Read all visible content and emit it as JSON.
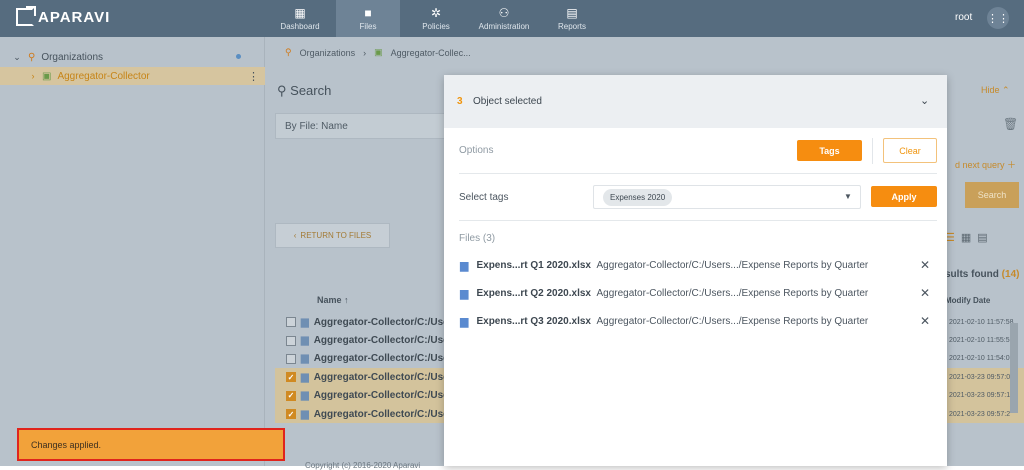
{
  "app": {
    "brand": "APARAVI"
  },
  "nav": [
    {
      "label": "Dashboard",
      "icon": "dashboard-icon"
    },
    {
      "label": "Files",
      "icon": "folder-icon"
    },
    {
      "label": "Policies",
      "icon": "gear-icon"
    },
    {
      "label": "Administration",
      "icon": "people-icon"
    },
    {
      "label": "Reports",
      "icon": "clipboard-icon"
    }
  ],
  "user": {
    "name": "root"
  },
  "sidebar": {
    "root": {
      "label": "Organizations"
    },
    "child": {
      "label": "Aggregator-Collector"
    }
  },
  "breadcrumb": [
    "Organizations",
    "Aggregator-Collec..."
  ],
  "search": {
    "title": "Search",
    "by_file": "By File: Name",
    "hide_label": "Hide",
    "next_query": "d next query",
    "search_button": "Search"
  },
  "results": {
    "return_label": "RETURN TO FILES",
    "found_label": "sults found",
    "count": "(14)",
    "col_name": "Name",
    "col_date": "Modify Date",
    "rows": [
      {
        "path": "Aggregator-Collector/C:/Use",
        "date": "2021-02-10 11:57:58",
        "checked": false
      },
      {
        "path": "Aggregator-Collector/C:/Use",
        "date": "2021-02-10 11:55:59",
        "checked": false
      },
      {
        "path": "Aggregator-Collector/C:/Use",
        "date": "2021-02-10 11:54:01",
        "checked": false
      },
      {
        "path": "Aggregator-Collector/C:/Use",
        "date": "2021-03-23 09:57:0",
        "checked": true
      },
      {
        "path": "Aggregator-Collector/C:/Use",
        "date": "2021-03-23 09:57:1",
        "checked": true
      },
      {
        "path": "Aggregator-Collector/C:/Use",
        "date": "2021-03-23 09:57:2",
        "checked": true
      }
    ]
  },
  "footer": {
    "copyright": "Copyright (c) 2016-2020 Aparavi"
  },
  "modal": {
    "selected_count": "3",
    "selected_text": "Object selected",
    "options_label": "Options",
    "tags_button": "Tags",
    "clear_button": "Clear",
    "select_tags_label": "Select tags",
    "selected_tag": "Expenses 2020",
    "apply_button": "Apply",
    "files_label": "Files (3)",
    "files": [
      {
        "name": "Expens...rt Q1 2020.xlsx",
        "path": "Aggregator-Collector/C:/Users.../Expense Reports by Quarter"
      },
      {
        "name": "Expens...rt Q2 2020.xlsx",
        "path": "Aggregator-Collector/C:/Users.../Expense Reports by Quarter"
      },
      {
        "name": "Expens...rt Q3 2020.xlsx",
        "path": "Aggregator-Collector/C:/Users.../Expense Reports by Quarter"
      }
    ]
  },
  "toast": {
    "message": "Changes applied."
  },
  "colors": {
    "accent": "#f68d10",
    "topbar": "#566c7f",
    "toast_border": "#e0241c"
  }
}
